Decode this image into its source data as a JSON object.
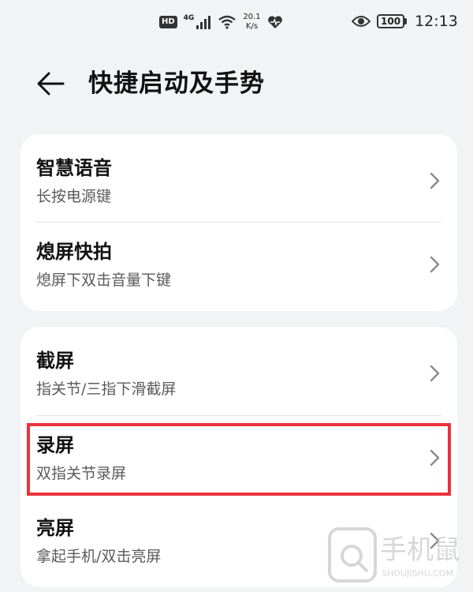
{
  "status_bar": {
    "hd": "HD",
    "network_type": "4G",
    "speed_value": "20.1",
    "speed_unit": "K/s",
    "battery": "100",
    "time": "12:13"
  },
  "header": {
    "title": "快捷启动及手势"
  },
  "groups": [
    {
      "items": [
        {
          "title": "智慧语音",
          "subtitle": "长按电源键"
        },
        {
          "title": "熄屏快拍",
          "subtitle": "熄屏下双击音量下键"
        }
      ]
    },
    {
      "items": [
        {
          "title": "截屏",
          "subtitle": "指关节/三指下滑截屏"
        },
        {
          "title": "录屏",
          "subtitle": "双指关节录屏"
        },
        {
          "title": "亮屏",
          "subtitle": "拿起手机/双击亮屏"
        }
      ]
    }
  ],
  "highlight_color": "#E8333A",
  "watermark": {
    "text_main": "手机鼠",
    "text_url": "SHOUJISHU.COM"
  }
}
